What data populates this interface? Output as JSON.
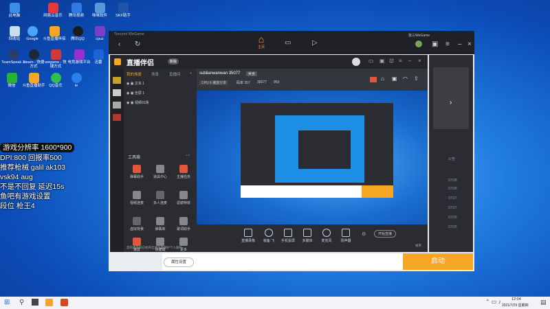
{
  "desktop": {
    "icons": [
      {
        "label": "此电脑",
        "color": "#3a8ee6"
      },
      {
        "label": "网易云音乐",
        "color": "#e23a3a"
      },
      {
        "label": "腾讯视频",
        "color": "#2f7ae5"
      },
      {
        "label": "咪咪软件",
        "color": "#5599dd"
      },
      {
        "label": "SKF助手",
        "color": "#2255aa"
      },
      {
        "label": "回收站",
        "color": "#c8dcf2"
      },
      {
        "label": "Google",
        "color": "#4aa3ff"
      },
      {
        "label": "斗鱼直播伴侣",
        "color": "#f5a623"
      },
      {
        "label": "腾讯QQ",
        "color": "#1b1b1b"
      },
      {
        "label": "cpuz",
        "color": "#7b3fc9"
      },
      {
        "label": "TeamSpeak 3",
        "color": "#2a3c6e"
      },
      {
        "label": "steam - 快捷方式",
        "color": "#1b2838"
      },
      {
        "label": "wegame - 快捷方式",
        "color": "#d13a3a"
      },
      {
        "label": "电竞游戏平台",
        "color": "#9a2fd0"
      },
      {
        "label": "迅雷",
        "color": "#1a66d6"
      },
      {
        "label": "微信",
        "color": "#25b33a"
      },
      {
        "label": "斗鱼直播助手",
        "color": "#f5a623"
      },
      {
        "label": "QQ音乐",
        "color": "#2fbf4f"
      },
      {
        "label": "ie",
        "color": "#2a80ee"
      }
    ],
    "overlay_lines": [
      "游戏分辨率 1600*900",
      "DPI:800 回报率500",
      "推荐枪械 galil ak103",
      "vsk94 aug",
      "不是不回复 延迟15s",
      "鱼吧有游戏设置",
      "段位 枪王4"
    ]
  },
  "main_window": {
    "brand": "Tencent WeGame",
    "home_label": "主页",
    "user": "张三WeGame",
    "colors": {
      "accent": "#f5a623",
      "top": "#1f2126"
    }
  },
  "live_app": {
    "logo": "直播伴侣",
    "version": "新版",
    "tabs": [
      "我的场景",
      "场景",
      "直播间",
      "+"
    ],
    "scenes": [
      "文本 1",
      "全屏 1",
      "视频01场"
    ],
    "tool_section_title": "工具箱",
    "tools": [
      "弹幕助手",
      "道具中心",
      "主播任务",
      "视频连麦",
      "多人连麦",
      "滤镜特效",
      "虚拟背景",
      "弹幕库",
      "歌词助手",
      "录屏",
      "快捷键",
      "更多"
    ],
    "stream_title": "sublianwanwan 35077",
    "stream_tag": "美食",
    "stats": [
      "CPU 6 播放分享",
      "码率 357",
      "35077",
      "953"
    ],
    "bottom_tools": [
      "直播录像",
      "装备.飞",
      "手机投屏",
      "多媒体",
      "麦克风",
      "扬声器"
    ],
    "footer_hint": "您的麦克风已经开启请注意保护个人隐私",
    "start_stream": "开始直播",
    "fps_label": "帧率"
  },
  "start_bar": {
    "settings_label": "属性设置",
    "start_label": "启动"
  },
  "right_panel": {
    "items": [
      "公告",
      "07/28",
      "07/28",
      "07/27",
      "07/27",
      "07/26",
      "07/25"
    ]
  },
  "taskbar": {
    "time": "12:04",
    "date": "2021/7/29 星期四"
  }
}
